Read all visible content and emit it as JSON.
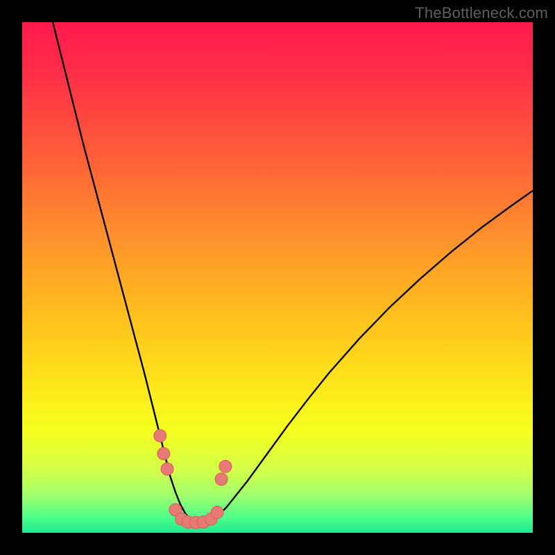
{
  "attribution": "TheBottleneck.com",
  "colors": {
    "frame_bg": "#000000",
    "curve": "#000000",
    "marker_fill": "#e77a74",
    "marker_stroke": "#d85f58",
    "gradient_stops": [
      {
        "offset": 0.0,
        "color": "#ff1a4d"
      },
      {
        "offset": 0.1,
        "color": "#ff2e48"
      },
      {
        "offset": 0.25,
        "color": "#ff5a3a"
      },
      {
        "offset": 0.4,
        "color": "#ff8a2e"
      },
      {
        "offset": 0.55,
        "color": "#ffb81f"
      },
      {
        "offset": 0.7,
        "color": "#ffe21a"
      },
      {
        "offset": 0.8,
        "color": "#f4ff1f"
      },
      {
        "offset": 0.88,
        "color": "#d2ff4a"
      },
      {
        "offset": 0.93,
        "color": "#9cff70"
      },
      {
        "offset": 0.97,
        "color": "#4dff8a"
      },
      {
        "offset": 1.0,
        "color": "#1fe890"
      }
    ]
  },
  "chart_data": {
    "type": "line",
    "title": "",
    "xlabel": "",
    "ylabel": "",
    "xlim": [
      0,
      100
    ],
    "ylim": [
      0,
      100
    ],
    "series": [
      {
        "name": "curve",
        "x": [
          6,
          8,
          10,
          12,
          14,
          16,
          18,
          20,
          22,
          24,
          25,
          26,
          27,
          28,
          29,
          30,
          31,
          32,
          33,
          34,
          36,
          38,
          40,
          44,
          48,
          52,
          56,
          60,
          66,
          72,
          78,
          84,
          90,
          96,
          100
        ],
        "y": [
          100,
          92,
          84,
          76,
          68.5,
          61,
          53.5,
          46,
          38.5,
          31,
          27,
          23,
          19,
          15,
          11,
          8,
          5.5,
          3.7,
          2.6,
          2.1,
          2.1,
          3.0,
          5.0,
          10.0,
          15.5,
          21.0,
          26.2,
          31.2,
          38.0,
          44.2,
          49.8,
          55.0,
          59.8,
          64.2,
          67.0
        ]
      }
    ],
    "markers": [
      {
        "x": 27.0,
        "y": 19.0
      },
      {
        "x": 27.7,
        "y": 15.5
      },
      {
        "x": 28.4,
        "y": 12.5
      },
      {
        "x": 30.0,
        "y": 4.5
      },
      {
        "x": 31.2,
        "y": 2.7
      },
      {
        "x": 32.5,
        "y": 2.1
      },
      {
        "x": 34.0,
        "y": 2.0
      },
      {
        "x": 35.5,
        "y": 2.1
      },
      {
        "x": 37.0,
        "y": 2.7
      },
      {
        "x": 38.2,
        "y": 4.0
      },
      {
        "x": 39.0,
        "y": 10.5
      },
      {
        "x": 39.8,
        "y": 13.0
      }
    ]
  }
}
